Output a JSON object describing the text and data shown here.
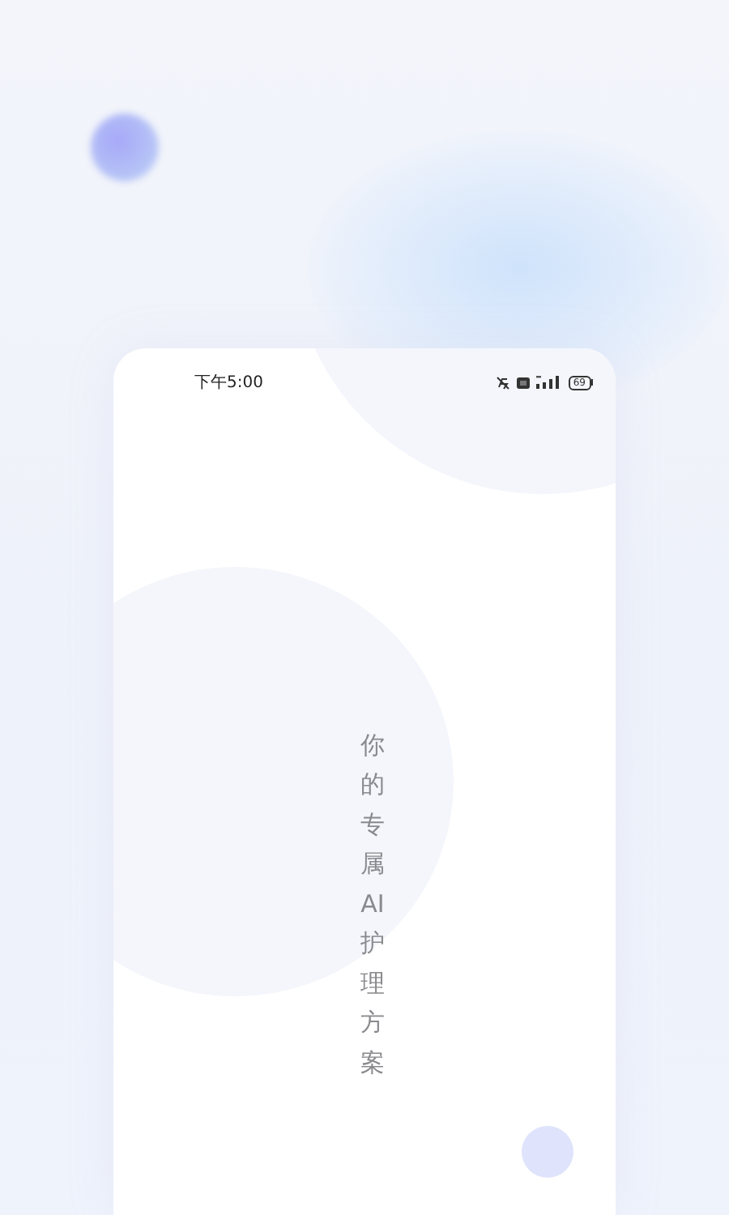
{
  "status_bar": {
    "time": "下午5:00",
    "battery": "69"
  },
  "slogan": "你的专属AI护理方案"
}
